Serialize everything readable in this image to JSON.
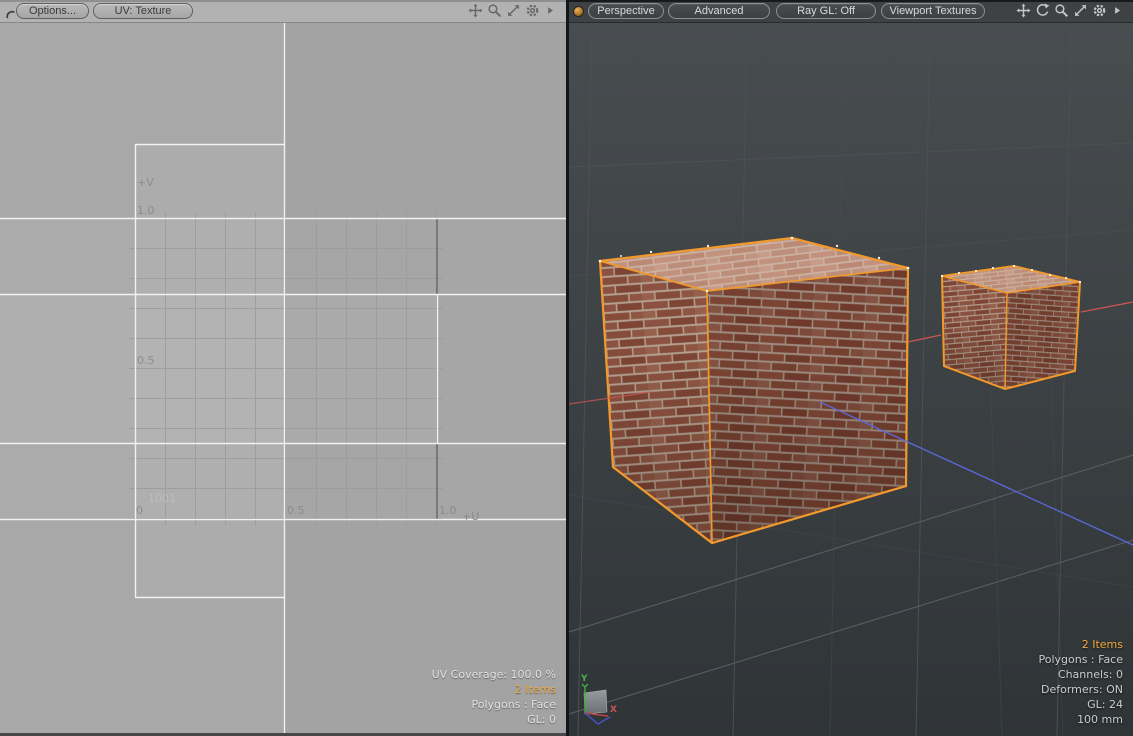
{
  "left_panel": {
    "toolbar": {
      "options_button": "Options...",
      "uv_mode_button": "UV: Texture"
    },
    "uv_editor": {
      "v_axis_label": "+V",
      "u_axis_label": "+U",
      "v_tick_1": "1.0",
      "v_tick_05": "0.5",
      "origin_tick": "0",
      "u_tick_05": "0.5",
      "u_tick_1": "1.0",
      "udim_tile_label": "1001"
    },
    "status": {
      "uv_coverage": "UV Coverage: 100.0 %",
      "items": "2 Items",
      "polygons": "Polygons : Face",
      "gl": "GL: 0"
    }
  },
  "right_panel": {
    "toolbar": {
      "view_type_button": "Perspective",
      "shading_button": "Advanced",
      "ray_gl_button": "Ray GL: Off",
      "viewport_textures_button": "Viewport Textures"
    },
    "status": {
      "items": "2 Items",
      "polygons": "Polygons : Face",
      "channels": "Channels: 0",
      "deformers": "Deformers: ON",
      "gl": "GL: 24",
      "grid_size": "100 mm"
    },
    "gizmo": {
      "x_label": "X",
      "y_label": "Y"
    }
  },
  "icons": {
    "left_toolbar": [
      "pan-icon",
      "zoom-icon",
      "expand-icon",
      "gear-icon",
      "flyout-arrow-icon"
    ],
    "right_toolbar": [
      "pan-icon",
      "rotate-icon",
      "zoom-icon",
      "expand-icon",
      "gear-icon",
      "flyout-arrow-icon"
    ],
    "widget": [
      "arc-handle-icon",
      "viewport-sphere-icon"
    ]
  },
  "colors": {
    "selection_orange": "#f2992b",
    "status_accent_orange": "#f2a73c",
    "axis_x_red": "#d05454",
    "axis_z_blue": "#5b68da",
    "axis_y_green": "#3fae3f",
    "uv_background": "#a5a5a5",
    "viewport_background": "#3a3f42"
  }
}
